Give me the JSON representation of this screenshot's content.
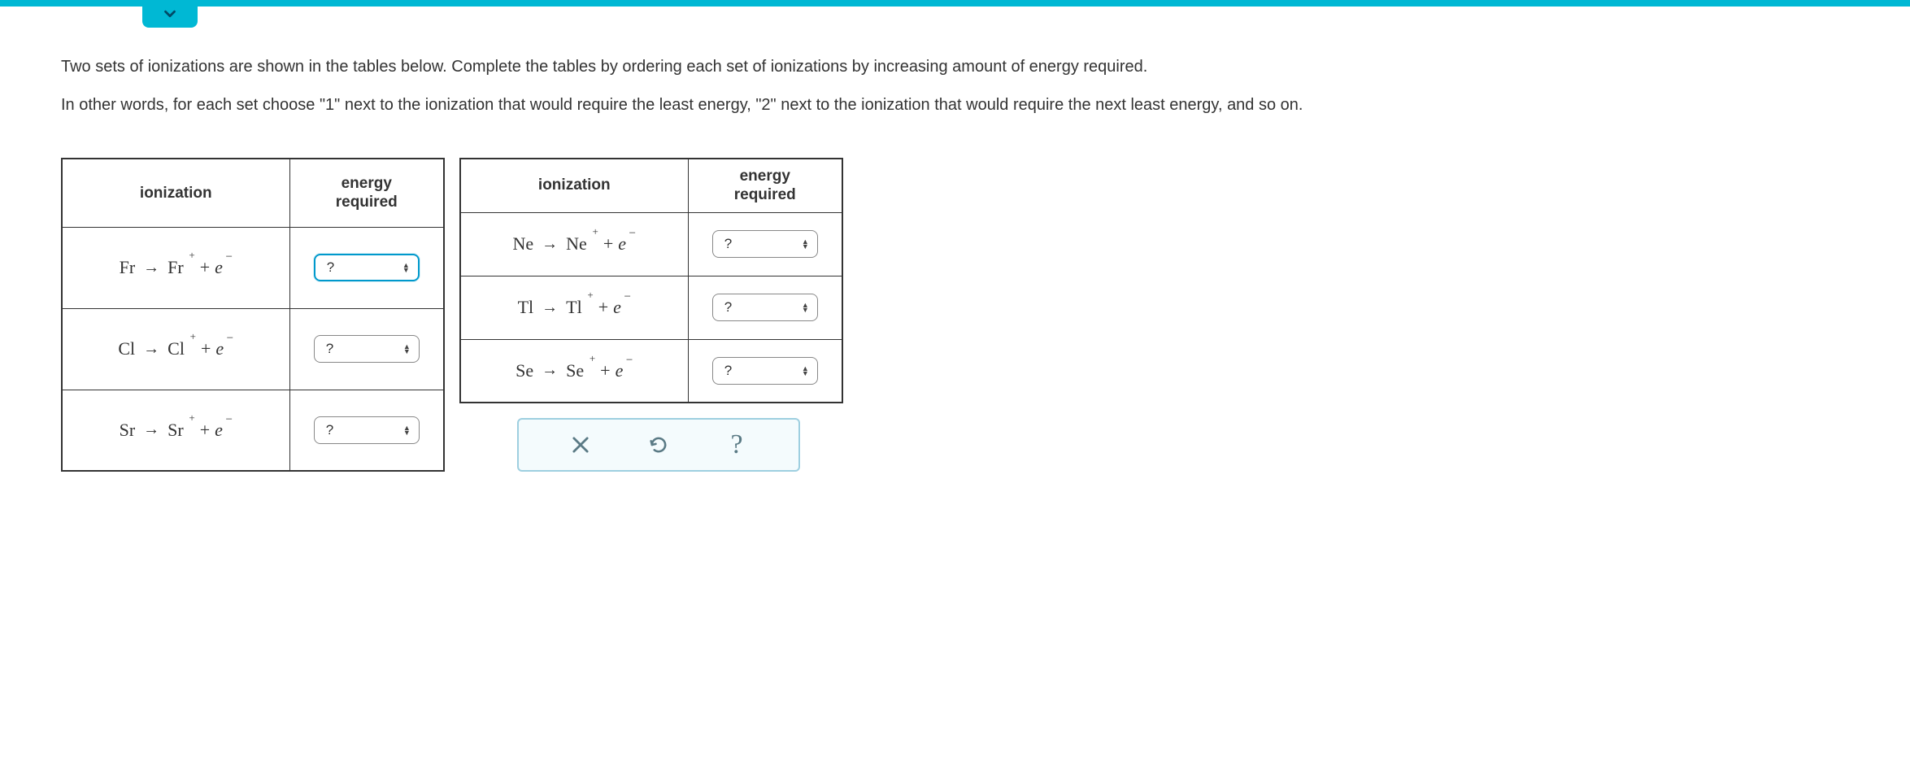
{
  "instructions": {
    "p1": "Two sets of ionizations are shown in the tables below. Complete the tables by ordering each set of ionizations by increasing amount of energy required.",
    "p2": "In other words, for each set choose \"1\" next to the ionization that would require the least energy, \"2\" next to the ionization that would require the next least energy, and so on."
  },
  "headers": {
    "ionization": "ionization",
    "energy": "energy\nrequired"
  },
  "select_placeholder": "?",
  "table1": {
    "rows": [
      {
        "left": "Fr",
        "right": "Fr",
        "focused": true
      },
      {
        "left": "Cl",
        "right": "Cl",
        "focused": false
      },
      {
        "left": "Sr",
        "right": "Sr",
        "focused": false
      }
    ]
  },
  "table2": {
    "rows": [
      {
        "left": "Ne",
        "right": "Ne",
        "focused": false
      },
      {
        "left": "Tl",
        "right": "Tl",
        "focused": false
      },
      {
        "left": "Se",
        "right": "Se",
        "focused": false
      }
    ]
  },
  "toolbar": {
    "clear": "clear",
    "reset": "reset",
    "help": "help"
  }
}
